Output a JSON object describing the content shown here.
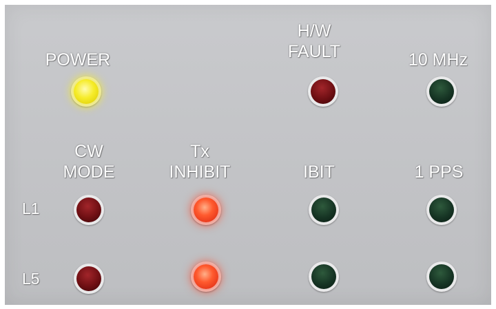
{
  "indicators": {
    "power": {
      "label": "POWER",
      "state": "on",
      "color": "#f6ec2a"
    },
    "hw_fault": {
      "label_line1": "H/W",
      "label_line2": "FAULT",
      "state": "off",
      "color": "#6e0f13"
    },
    "ten_mhz": {
      "label": "10 MHz",
      "state": "off",
      "color": "#163424"
    },
    "cw_mode": {
      "label_line1": "CW",
      "label_line2": "MODE"
    },
    "tx_inhibit": {
      "label_line1": "Tx",
      "label_line2": "INHIBIT"
    },
    "ibit": {
      "label": "IBIT"
    },
    "one_pps": {
      "label": "1 PPS"
    }
  },
  "rows": [
    {
      "label": "L1",
      "cw_mode": "off",
      "tx_inhibit": "on",
      "ibit": "off",
      "one_pps": "off"
    },
    {
      "label": "L5",
      "cw_mode": "off",
      "tx_inhibit": "on",
      "ibit": "off",
      "one_pps": "off"
    }
  ],
  "colors": {
    "panel": "#c6c7ca",
    "label_text": "#ffffff",
    "led_power_on": "#f6ec2a",
    "led_red_on": "#ff5a2e",
    "led_red_off": "#6e0f13",
    "led_green_off": "#163424"
  }
}
